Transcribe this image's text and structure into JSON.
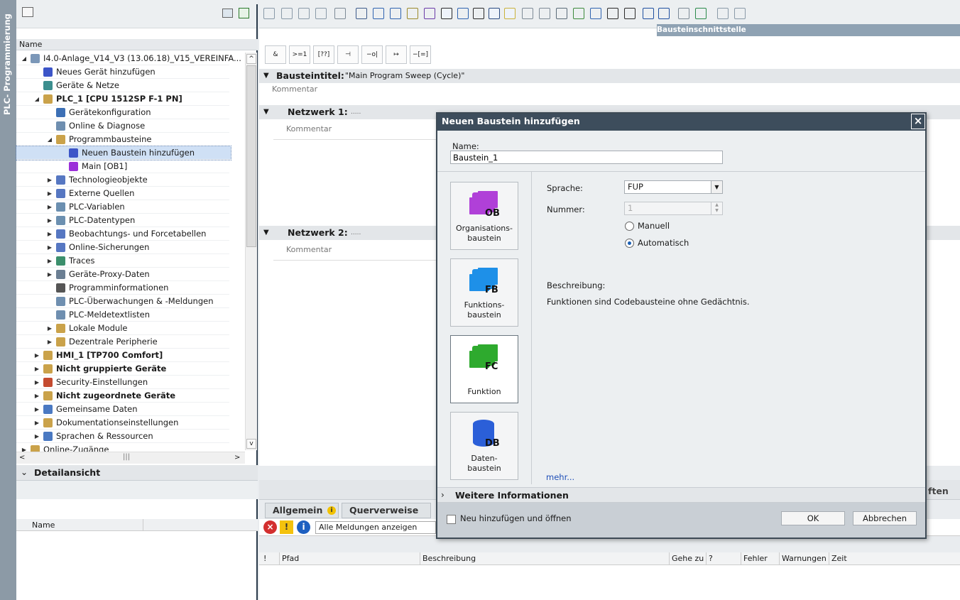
{
  "side_tab": "PLC- Programmierung",
  "tree": {
    "col_name": "Name",
    "items": [
      {
        "label": "I4.0-Anlage_V14_V3 (13.06.18)_V15_VEREINFA...",
        "expand": "open"
      },
      {
        "label": "Neues Gerät hinzufügen",
        "expand": ""
      },
      {
        "label": "Geräte & Netze",
        "expand": ""
      },
      {
        "label": "PLC_1 [CPU 1512SP F-1 PN]",
        "expand": "open"
      },
      {
        "label": "Gerätekonfiguration",
        "expand": ""
      },
      {
        "label": "Online & Diagnose",
        "expand": ""
      },
      {
        "label": "Programmbausteine",
        "expand": "open"
      },
      {
        "label": "Neuen Baustein hinzufügen",
        "expand": ""
      },
      {
        "label": "Main [OB1]",
        "expand": ""
      },
      {
        "label": "Technologieobjekte",
        "expand": "closed"
      },
      {
        "label": "Externe Quellen",
        "expand": "closed"
      },
      {
        "label": "PLC-Variablen",
        "expand": "closed"
      },
      {
        "label": "PLC-Datentypen",
        "expand": "closed"
      },
      {
        "label": "Beobachtungs- und Forcetabellen",
        "expand": "closed"
      },
      {
        "label": "Online-Sicherungen",
        "expand": "closed"
      },
      {
        "label": "Traces",
        "expand": "closed"
      },
      {
        "label": "Geräte-Proxy-Daten",
        "expand": "closed"
      },
      {
        "label": "Programminformationen",
        "expand": ""
      },
      {
        "label": "PLC-Überwachungen & -Meldungen",
        "expand": ""
      },
      {
        "label": "PLC-Meldetextlisten",
        "expand": ""
      },
      {
        "label": "Lokale Module",
        "expand": "closed"
      },
      {
        "label": "Dezentrale Peripherie",
        "expand": "closed"
      },
      {
        "label": "HMI_1 [TP700 Comfort]",
        "expand": "closed"
      },
      {
        "label": "Nicht gruppierte Geräte",
        "expand": "closed"
      },
      {
        "label": "Security-Einstellungen",
        "expand": "closed"
      },
      {
        "label": "Nicht zugeordnete Geräte",
        "expand": "closed"
      },
      {
        "label": "Gemeinsame Daten",
        "expand": "closed"
      },
      {
        "label": "Dokumentationseinstellungen",
        "expand": "closed"
      },
      {
        "label": "Sprachen & Ressourcen",
        "expand": "closed"
      },
      {
        "label": "Online-Zugänge",
        "expand": "closed"
      }
    ]
  },
  "detail": {
    "title": "Detailansicht",
    "col_name": "Name"
  },
  "editor": {
    "interface_bar": "Bausteinschnittstelle",
    "logic_buttons": [
      "&",
      ">=1",
      "[??]",
      "⊣",
      "−o|",
      "↦",
      "−[=]"
    ],
    "block_title_label": "Bausteintitel:",
    "block_title_value": "\"Main Program Sweep (Cycle)\"",
    "comment": "Kommentar",
    "network1": "Netzwerk 1:",
    "network2": "Netzwerk 2:",
    "dots": ".....",
    "right_cut": "ften"
  },
  "inspector": {
    "tab_general": "Allgemein",
    "tab_cross": "Querverweise",
    "filter": "Alle Meldungen anzeigen",
    "cols": [
      "!",
      "Pfad",
      "Beschreibung",
      "Gehe zu",
      "?",
      "Fehler",
      "Warnungen",
      "Zeit"
    ]
  },
  "dialog": {
    "title": "Neuen Baustein hinzufügen",
    "name_label": "Name:",
    "name_value": "Baustein_1",
    "blocks": [
      {
        "code": "OB",
        "caption1": "Organisations-",
        "caption2": "baustein",
        "color": "#b040d8"
      },
      {
        "code": "FB",
        "caption1": "Funktions-",
        "caption2": "baustein",
        "color": "#1e90e8"
      },
      {
        "code": "FC",
        "caption1": "Funktion",
        "caption2": "",
        "color": "#2eaa2e"
      },
      {
        "code": "DB",
        "caption1": "Daten-",
        "caption2": "baustein",
        "color": "#2b5fd8"
      }
    ],
    "lang_label": "Sprache:",
    "lang_value": "FUP",
    "num_label": "Nummer:",
    "num_value": "1",
    "manual": "Manuell",
    "auto": "Automatisch",
    "desc_label": "Beschreibung:",
    "desc_text": "Funktionen sind Codebausteine ohne Gedächtnis.",
    "more": "mehr...",
    "more_info": "Weitere Informationen",
    "add_open": "Neu hinzufügen und öffnen",
    "ok": "OK",
    "cancel": "Abbrechen"
  }
}
